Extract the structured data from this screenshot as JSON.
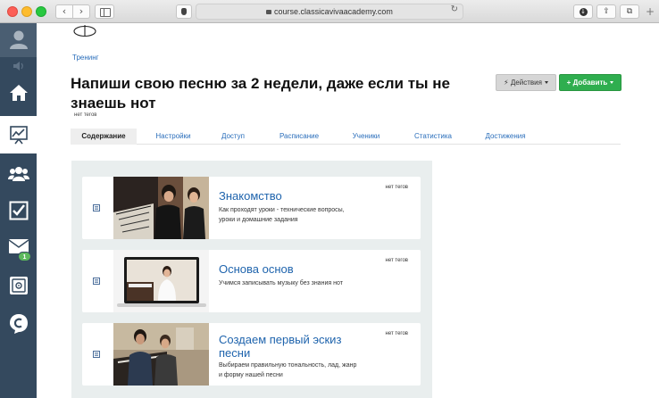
{
  "browser": {
    "url": "course.classicavivaacademy.com",
    "back_glyph": "‹",
    "forward_glyph": "›",
    "reload_glyph": "↻",
    "download_glyph": "↓",
    "share_glyph": "⇪",
    "tabs_glyph": "⧉",
    "new_tab_glyph": "+"
  },
  "sidebar": {
    "mail_badge": "1",
    "icons": [
      "user-icon",
      "sound-icon",
      "home-icon",
      "chart-icon",
      "users-icon",
      "checkbox-icon",
      "mail-icon",
      "safe-icon",
      "chat-icon"
    ]
  },
  "breadcrumb": "Тренинг",
  "title": "Напиши свою песню за 2 недели, даже если ты не знаешь нот",
  "tags_label": "нет тегов",
  "buttons": {
    "actions": "Действия",
    "add": "Добавить",
    "bolt": "⚡",
    "plus": "+"
  },
  "tabs": [
    {
      "label": "Содержание"
    },
    {
      "label": "Настройки"
    },
    {
      "label": "Доступ"
    },
    {
      "label": "Расписание"
    },
    {
      "label": "Ученики"
    },
    {
      "label": "Статистика"
    },
    {
      "label": "Достижения"
    }
  ],
  "lessons": [
    {
      "title": "Знакомство",
      "description": "Как проходят уроки - технические вопросы, уроки и домашние задания",
      "tags": "нет тегов"
    },
    {
      "title": "Основа основ",
      "description": "Учимся записывать музыку без знания нот",
      "tags": "нет тегов"
    },
    {
      "title": "Создаем первый эскиз песни",
      "description": "Выбираем правильную тональность, лад, жанр и форму нашей песни",
      "tags": "нет тегов"
    }
  ],
  "colors": {
    "sidebar": "#34495e",
    "link": "#1f64ad",
    "add_button": "#2fae4f",
    "panel": "#e9eeee"
  }
}
